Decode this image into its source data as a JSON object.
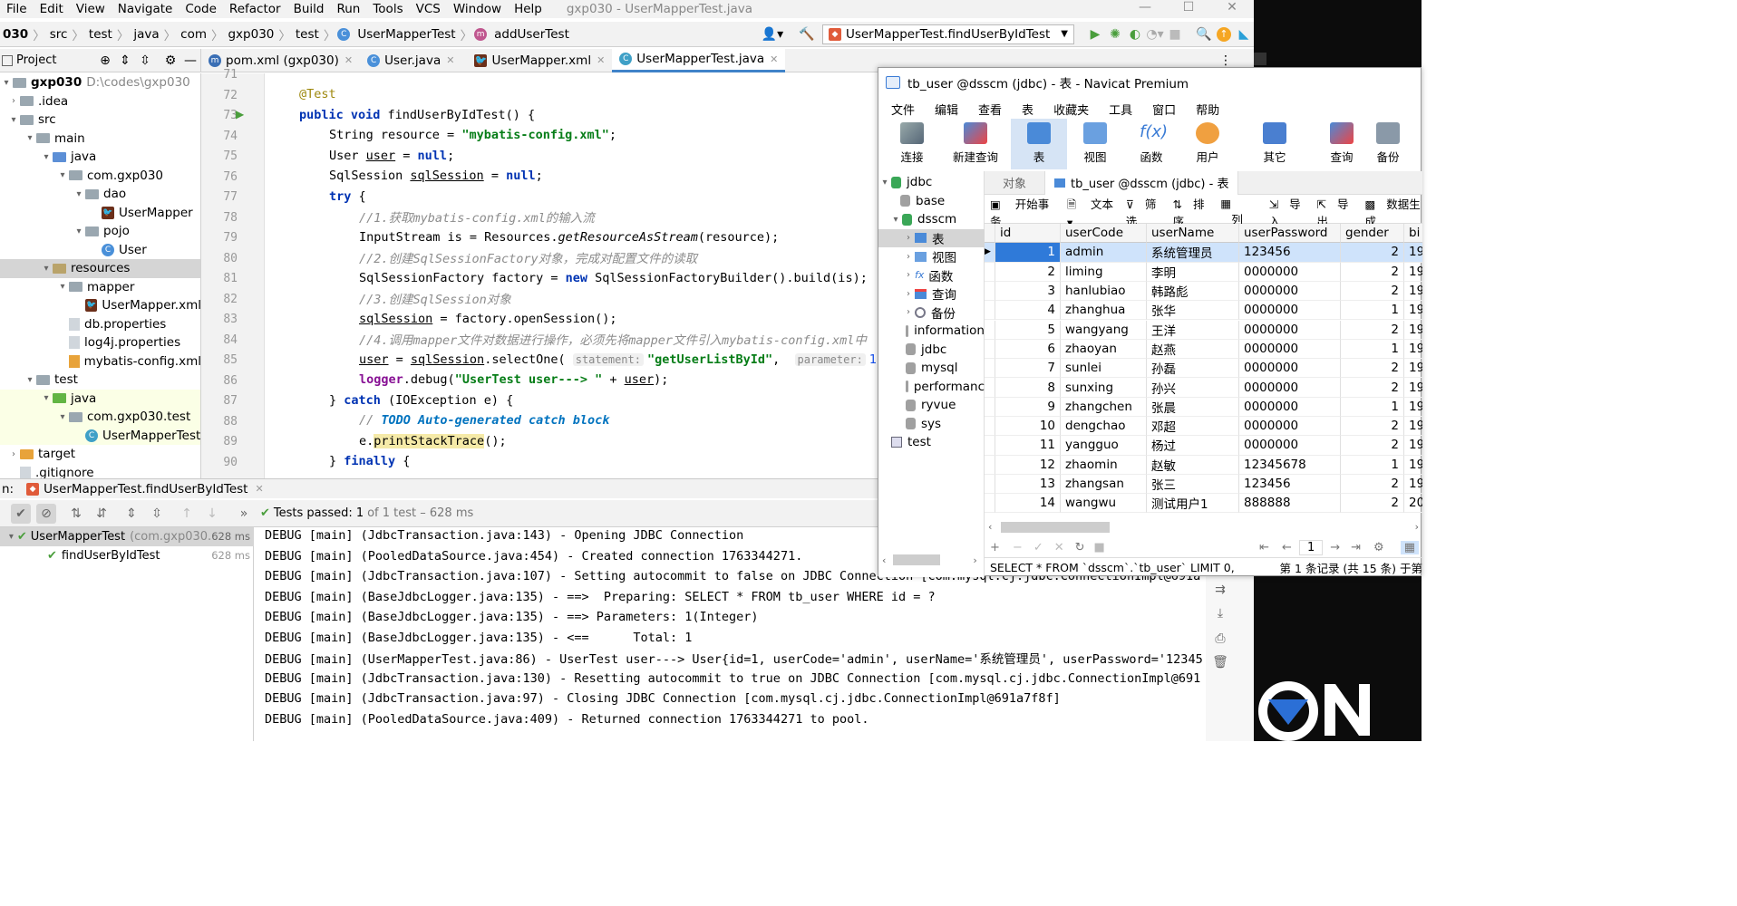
{
  "ide": {
    "menu": [
      "File",
      "Edit",
      "View",
      "Navigate",
      "Code",
      "Refactor",
      "Build",
      "Run",
      "Tools",
      "VCS",
      "Window",
      "Help"
    ],
    "window_title": "gxp030 - UserMapperTest.java",
    "breadcrumbs": [
      "030",
      "src",
      "test",
      "java",
      "com",
      "gxp030",
      "test",
      "UserMapperTest",
      "addUserTest"
    ],
    "run_config": "UserMapperTest.findUserByIdTest",
    "tool_label": "Project",
    "tabs": [
      "pom.xml (gxp030)",
      "User.java",
      "UserMapper.xml",
      "UserMapperTest.java"
    ],
    "project_tree": [
      {
        "label": "gxp030",
        "extra": "D:\\codes\\gxp030"
      },
      {
        "label": ".idea"
      },
      {
        "label": "src"
      },
      {
        "label": "main"
      },
      {
        "label": "java"
      },
      {
        "label": "com.gxp030"
      },
      {
        "label": "dao"
      },
      {
        "label": "UserMapper"
      },
      {
        "label": "pojo"
      },
      {
        "label": "User"
      },
      {
        "label": "resources"
      },
      {
        "label": "mapper"
      },
      {
        "label": "UserMapper.xml"
      },
      {
        "label": "db.properties"
      },
      {
        "label": "log4j.properties"
      },
      {
        "label": "mybatis-config.xml"
      },
      {
        "label": "test"
      },
      {
        "label": "java"
      },
      {
        "label": "com.gxp030.test"
      },
      {
        "label": "UserMapperTest"
      },
      {
        "label": "target"
      },
      {
        "label": ".gitignore"
      }
    ],
    "line_numbers": [
      "71",
      "72",
      "73",
      "74",
      "75",
      "76",
      "77",
      "78",
      "79",
      "80",
      "81",
      "82",
      "83",
      "84",
      "85",
      "86",
      "87",
      "88",
      "89",
      "90"
    ],
    "code": {
      "l72": "@Test",
      "l73a": "public void ",
      "l73b": "findUserByIdTest() {",
      "l74a": "String resource = ",
      "l74b": "\"mybatis-config.xml\"",
      "l74c": ";",
      "l75a": "User ",
      "l75b": "user",
      "l75c": " = ",
      "l75d": "null",
      "l75e": ";",
      "l76a": "SqlSession ",
      "l76b": "sqlSession",
      "l76c": " = ",
      "l76d": "null",
      "l76e": ";",
      "l77a": "try",
      "l77b": " {",
      "l78": "//1.获取mybatis-config.xml的输入流",
      "l79a": "InputStream is = Resources.",
      "l79b": "getResourceAsStream",
      "l79c": "(resource);",
      "l80": "//2.创建SqlSessionFactory对象，完成对配置文件的读取",
      "l81a": "SqlSessionFactory factory = ",
      "l81b": "new",
      "l81c": " SqlSessionFactoryBuilder().build(is);",
      "l82": "//3.创建SqlSession对象",
      "l83a": "sqlSession",
      "l83b": " = factory.openSession();",
      "l84": "//4.调用mapper文件对数据进行操作，必须先将mapper文件引入mybatis-config.xml中",
      "l85a": "user",
      "l85b": " = ",
      "l85c": "sqlSession",
      "l85d": ".selectOne( ",
      "l85e": "statement:",
      "l85f": "\"getUserListById\"",
      "l85g": ",  ",
      "l85h": "parameter:",
      "l85i": "1",
      ");": "",
      "l85j": ");",
      "l86a": "logger",
      "l86b": ".debug(",
      "l86c": "\"UserTest user---> \"",
      "l86d": " + ",
      "l86e": "user",
      "l86f": ");",
      "l87a": "} ",
      "l87b": "catch",
      "l87c": " (IOException e) {",
      "l88a": "// ",
      "l88b": "TODO Auto-generated catch block",
      "l89a": "e.",
      "l89b": "printStackTrace",
      "l89c": "();",
      "l90a": "} ",
      "l90b": "finally",
      "l90c": " {"
    },
    "run": {
      "label": "n:",
      "tab": "UserMapperTest.findUserByIdTest",
      "status_bold": "Tests passed:",
      "status_count": "1",
      "status_rest": "of 1 test – 628 ms",
      "tests": [
        {
          "name": "UserMapperTest",
          "pkg": "(com.gxp030.",
          "time": "628 ms"
        },
        {
          "name": "findUserByIdTest",
          "time": "628 ms"
        }
      ],
      "console": [
        "DEBUG [main] (JdbcTransaction.java:143) - Opening JDBC Connection",
        "DEBUG [main] (PooledDataSource.java:454) - Created connection 1763344271.",
        "DEBUG [main] (JdbcTransaction.java:107) - Setting autocommit to false on JDBC Connection [com.mysql.cj.jdbc.ConnectionImpl@691a",
        "DEBUG [main] (BaseJdbcLogger.java:135) - ==>  Preparing: SELECT * FROM tb_user WHERE id = ?",
        "DEBUG [main] (BaseJdbcLogger.java:135) - ==> Parameters: 1(Integer)",
        "DEBUG [main] (BaseJdbcLogger.java:135) - <==      Total: 1",
        "DEBUG [main] (UserMapperTest.java:86) - UserTest user---> User{id=1, userCode='admin', userName='系统管理员', userPassword='12345",
        "DEBUG [main] (JdbcTransaction.java:130) - Resetting autocommit to true on JDBC Connection [com.mysql.cj.jdbc.ConnectionImpl@691",
        "DEBUG [main] (JdbcTransaction.java:97) - Closing JDBC Connection [com.mysql.cj.jdbc.ConnectionImpl@691a7f8f]",
        "DEBUG [main] (PooledDataSource.java:409) - Returned connection 1763344271 to pool."
      ]
    }
  },
  "navicat": {
    "title": "tb_user @dsscm (jdbc) - 表 - Navicat Premium",
    "menu": [
      "文件",
      "编辑",
      "查看",
      "表",
      "收藏夹",
      "工具",
      "窗口",
      "帮助"
    ],
    "toolbar": [
      "连接",
      "新建查询",
      "表",
      "视图",
      "函数",
      "用户",
      "其它",
      "查询",
      "备份"
    ],
    "tree": [
      "jdbc",
      "base",
      "dsscm",
      "表",
      "视图",
      "函数",
      "查询",
      "备份",
      "information",
      "jdbc",
      "mysql",
      "performanc",
      "ryvue",
      "sys",
      "test"
    ],
    "tabs": [
      "对象",
      "tb_user @dsscm (jdbc) - 表"
    ],
    "subtoolbar": [
      "开始事务",
      "文本",
      "筛选",
      "排序",
      "列",
      "导入",
      "导出",
      "数据生成"
    ],
    "columns": [
      "id",
      "userCode",
      "userName",
      "userPassword",
      "gender",
      "bi"
    ],
    "rows": [
      [
        "1",
        "admin",
        "系统管理员",
        "123456",
        "2",
        "19"
      ],
      [
        "2",
        "liming",
        "李明",
        "0000000",
        "2",
        "19"
      ],
      [
        "3",
        "hanlubiao",
        "韩路彪",
        "0000000",
        "2",
        "19"
      ],
      [
        "4",
        "zhanghua",
        "张华",
        "0000000",
        "1",
        "19"
      ],
      [
        "5",
        "wangyang",
        "王洋",
        "0000000",
        "2",
        "19"
      ],
      [
        "6",
        "zhaoyan",
        "赵燕",
        "0000000",
        "1",
        "19"
      ],
      [
        "7",
        "sunlei",
        "孙磊",
        "0000000",
        "2",
        "19"
      ],
      [
        "8",
        "sunxing",
        "孙兴",
        "0000000",
        "2",
        "19"
      ],
      [
        "9",
        "zhangchen",
        "张晨",
        "0000000",
        "1",
        "19"
      ],
      [
        "10",
        "dengchao",
        "邓超",
        "0000000",
        "2",
        "19"
      ],
      [
        "11",
        "yangguo",
        "杨过",
        "0000000",
        "2",
        "19"
      ],
      [
        "12",
        "zhaomin",
        "赵敏",
        "12345678",
        "1",
        "19"
      ],
      [
        "13",
        "zhangsan",
        "张三",
        "123456",
        "2",
        "19"
      ],
      [
        "14",
        "wangwu",
        "测试用户1",
        "888888",
        "2",
        "20"
      ]
    ],
    "page": "1",
    "sql": "SELECT * FROM `dsscm`.`tb_user` LIMIT 0,",
    "record": "第 1 条记录 (共 15 条)  于第"
  }
}
